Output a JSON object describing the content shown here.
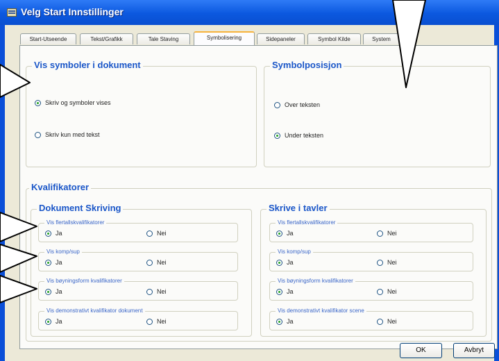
{
  "window": {
    "title": "Velg Start Innstillinger"
  },
  "tabs": [
    {
      "label": "Start-Utseende",
      "active": false
    },
    {
      "label": "Tekst/Grafikk",
      "active": false
    },
    {
      "label": "Tale Staving",
      "active": false
    },
    {
      "label": "Symbolisering",
      "active": true
    },
    {
      "label": "Sidepaneler",
      "active": false
    },
    {
      "label": "Symbol Kilde",
      "active": false
    },
    {
      "label": "System",
      "active": false
    }
  ],
  "vis_symboler": {
    "title": "Vis symboler i dokument",
    "options": [
      {
        "label": "Skriv og symboler vises",
        "selected": true
      },
      {
        "label": "Skriv kun med tekst",
        "selected": false
      }
    ]
  },
  "symbolposisjon": {
    "title": "Symbolposisjon",
    "options": [
      {
        "label": "Over teksten",
        "selected": false
      },
      {
        "label": "Under teksten",
        "selected": true
      }
    ]
  },
  "kvalifikatorer": {
    "title": "Kvalifikatorer",
    "dokument": {
      "title": "Dokument Skriving",
      "rows": [
        {
          "label": "Vis flertallskvalifikatorer",
          "yes": "Ja",
          "no": "Nei",
          "selected": "yes"
        },
        {
          "label": "Vis komp/sup",
          "yes": "Ja",
          "no": "Nei",
          "selected": "yes"
        },
        {
          "label": "Vis bøyningsform kvalifikatorer",
          "yes": "Ja",
          "no": "Nei",
          "selected": "yes"
        },
        {
          "label": "Vis demonstrativt kvalifikator dokument",
          "yes": "Ja",
          "no": "Nei",
          "selected": "yes"
        }
      ]
    },
    "tavler": {
      "title": "Skrive i tavler",
      "rows": [
        {
          "label": "Vis flertallskvalifikatorer",
          "yes": "Ja",
          "no": "Nei",
          "selected": "yes"
        },
        {
          "label": "Vis komp/sup",
          "yes": "Ja",
          "no": "Nei",
          "selected": "yes"
        },
        {
          "label": "Vis bøyningsform kvalifikatorer",
          "yes": "Ja",
          "no": "Nei",
          "selected": "yes"
        },
        {
          "label": "Vis demonstrativt kvalifikator scene",
          "yes": "Ja",
          "no": "Nei",
          "selected": "yes"
        }
      ]
    }
  },
  "buttons": {
    "ok": "OK",
    "cancel": "Avbryt"
  },
  "colors": {
    "title_bar": "#0b58df",
    "group_title": "#1a56c8",
    "tab_highlight": "#f7b33b",
    "radio_dot": "#21a121"
  }
}
